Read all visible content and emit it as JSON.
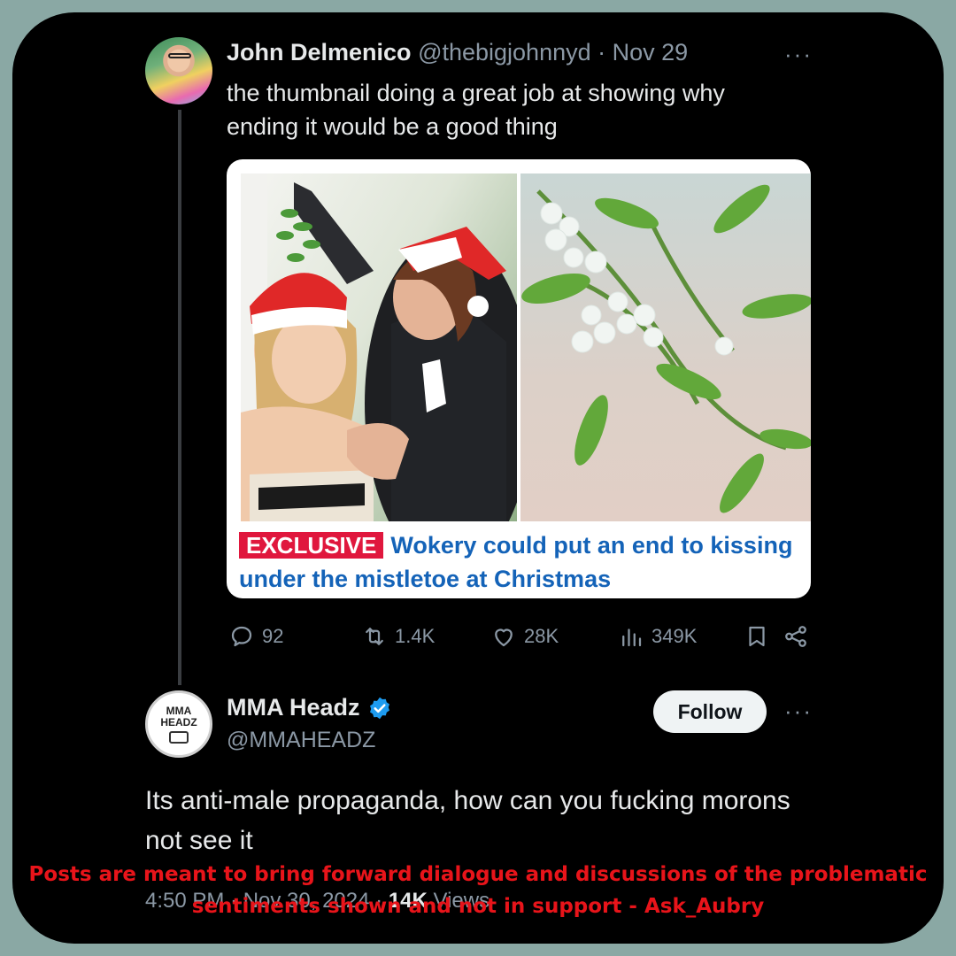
{
  "tweet": {
    "author_name": "John Delmenico",
    "author_handle": "@thebigjohnnyd",
    "separator": " · ",
    "date": "Nov 29",
    "more": "···",
    "text": "the thumbnail doing a great job at showing why ending it would be a good thing",
    "card": {
      "badge": "EXCLUSIVE",
      "headline": "Wokery could put an end to kissing under the mistletoe at Christmas"
    },
    "actions": {
      "replies": "92",
      "reposts": "1.4K",
      "likes": "28K",
      "views": "349K"
    }
  },
  "reply": {
    "avatar_line1": "MMA",
    "avatar_line2": "HEADZ",
    "author_name": "MMA Headz",
    "author_handle": "@MMAHEADZ",
    "follow_label": "Follow",
    "more": "···",
    "text": "Its anti-male propaganda, how can you fucking morons not see it",
    "time": "4:50 PM · Nov 30, 2024 · ",
    "views_count": "14K",
    "views_label": " Views"
  },
  "overlay_text": "Posts are meant to bring forward dialogue and discussions of the problematic sentiments shown and not in support - Ask_Aubry",
  "colors": {
    "background": "#8aa8a4",
    "panel": "#000000",
    "verified": "#1d9bf0",
    "overlay": "#e8141a",
    "badge": "#e0173d",
    "headline": "#1463b8"
  }
}
